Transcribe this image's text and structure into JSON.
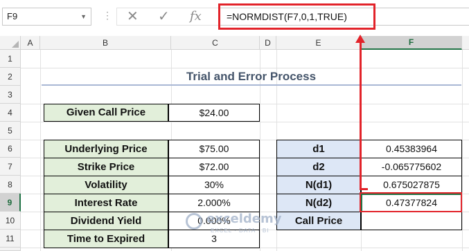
{
  "formula_bar": {
    "name_box": "F9",
    "cancel_icon": "✕",
    "enter_icon": "✓",
    "fx_label": "fx",
    "formula": "=NORMDIST(F7,0,1,TRUE)"
  },
  "columns": [
    "A",
    "B",
    "C",
    "D",
    "E",
    "F"
  ],
  "rows": [
    "1",
    "2",
    "3",
    "4",
    "5",
    "6",
    "7",
    "8",
    "9",
    "10",
    "11"
  ],
  "selected_cell": {
    "column": "F",
    "row": "9"
  },
  "sheet": {
    "title": "Trial and Error Process",
    "given": {
      "label": "Given Call Price",
      "value": "$24.00"
    },
    "inputs": [
      {
        "label": "Underlying Price",
        "value": "$75.00"
      },
      {
        "label": "Strike Price",
        "value": "$72.00"
      },
      {
        "label": "Volatility",
        "value": "30%"
      },
      {
        "label": "Interest Rate",
        "value": "2.000%"
      },
      {
        "label": "Dividend Yield",
        "value": "0.000%"
      },
      {
        "label": "Time to Expired",
        "value": "3"
      }
    ],
    "outputs": [
      {
        "label": "d1",
        "value": "0.45383964"
      },
      {
        "label": "d2",
        "value": "-0.065775602"
      },
      {
        "label": "N(d1)",
        "value": "0.675027875"
      },
      {
        "label": "N(d2)",
        "value": "0.47377824"
      },
      {
        "label": "Call Price",
        "value": ""
      }
    ]
  },
  "watermark": {
    "name": "exceldemy",
    "tagline": "EXCEL · DATA · BI"
  },
  "colors": {
    "label_green": "#e2efda",
    "label_blue": "#dde7f6",
    "highlight_red": "#e2232a",
    "excel_green": "#217346"
  }
}
